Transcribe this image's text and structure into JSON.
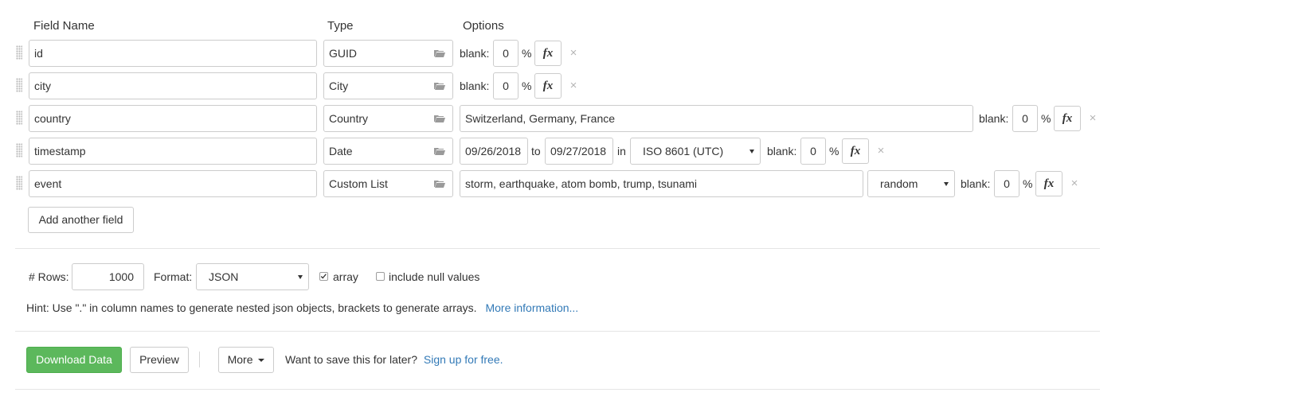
{
  "headers": {
    "field_name": "Field Name",
    "type": "Type",
    "options": "Options"
  },
  "fields": [
    {
      "name": "id",
      "type": "GUID"
    },
    {
      "name": "city",
      "type": "City"
    },
    {
      "name": "country",
      "type": "Country"
    },
    {
      "name": "timestamp",
      "type": "Date"
    },
    {
      "name": "event",
      "type": "Custom List"
    }
  ],
  "common": {
    "blank_label": "blank:",
    "blank_value": "0",
    "percent": "%",
    "fx": "fx",
    "remove": "×"
  },
  "country_options": {
    "values": "Switzerland, Germany, France"
  },
  "date_options": {
    "from": "09/26/2018",
    "to_label": "to",
    "to": "09/27/2018",
    "in_label": "in",
    "format": "ISO 8601 (UTC)"
  },
  "custom_list_options": {
    "values": "storm, earthquake, atom bomb, trump, tsunami",
    "mode": "random"
  },
  "add_field_label": "Add another field",
  "settings": {
    "rows_label": "# Rows:",
    "rows_value": "1000",
    "format_label": "Format:",
    "format_value": "JSON",
    "array_label": "array",
    "array_checked": true,
    "include_null_label": "include null values",
    "include_null_checked": false
  },
  "hint": {
    "text": "Hint: Use \".\" in column names to generate nested json objects, brackets to generate arrays.",
    "link": "More information..."
  },
  "actions": {
    "download_label": "Download Data",
    "preview_label": "Preview",
    "more_label": "More",
    "save_prompt": "Want to save this for later?",
    "signup_link": "Sign up for free."
  },
  "colors": {
    "download_bg": "#5cb85c",
    "link": "#337ab7",
    "border": "#cccccc"
  }
}
